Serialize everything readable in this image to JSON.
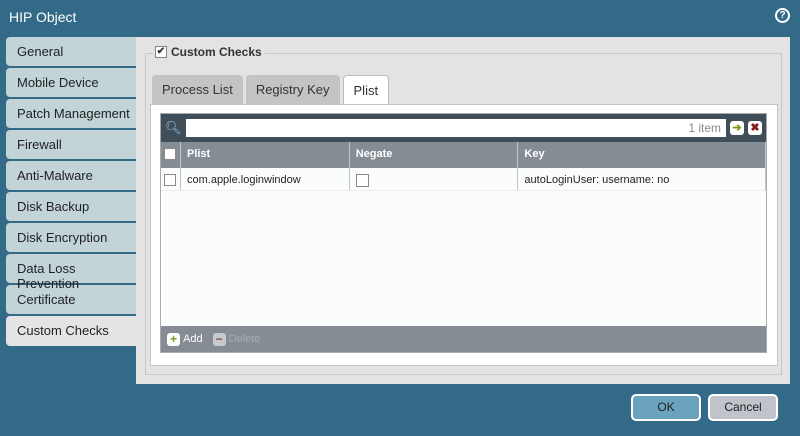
{
  "window": {
    "title": "HIP Object",
    "help": "?"
  },
  "sidebar": {
    "items": [
      {
        "label": "General"
      },
      {
        "label": "Mobile Device"
      },
      {
        "label": "Patch Management"
      },
      {
        "label": "Firewall"
      },
      {
        "label": "Anti-Malware"
      },
      {
        "label": "Disk Backup"
      },
      {
        "label": "Disk Encryption"
      },
      {
        "label": "Data Loss Prevention"
      },
      {
        "label": "Certificate"
      },
      {
        "label": "Custom Checks"
      }
    ]
  },
  "section": {
    "label": "Custom Checks",
    "checked": true
  },
  "tabs": [
    {
      "label": "Process List"
    },
    {
      "label": "Registry Key"
    },
    {
      "label": "Plist"
    }
  ],
  "grid": {
    "count": "1 item",
    "columns": [
      "Plist",
      "Negate",
      "Key"
    ],
    "rows": [
      {
        "plist": "com.apple.loginwindow",
        "negate": false,
        "key": "autoLoginUser: username: no"
      }
    ],
    "add": "Add",
    "delete": "Delete"
  },
  "buttons": {
    "ok": "OK",
    "cancel": "Cancel"
  }
}
